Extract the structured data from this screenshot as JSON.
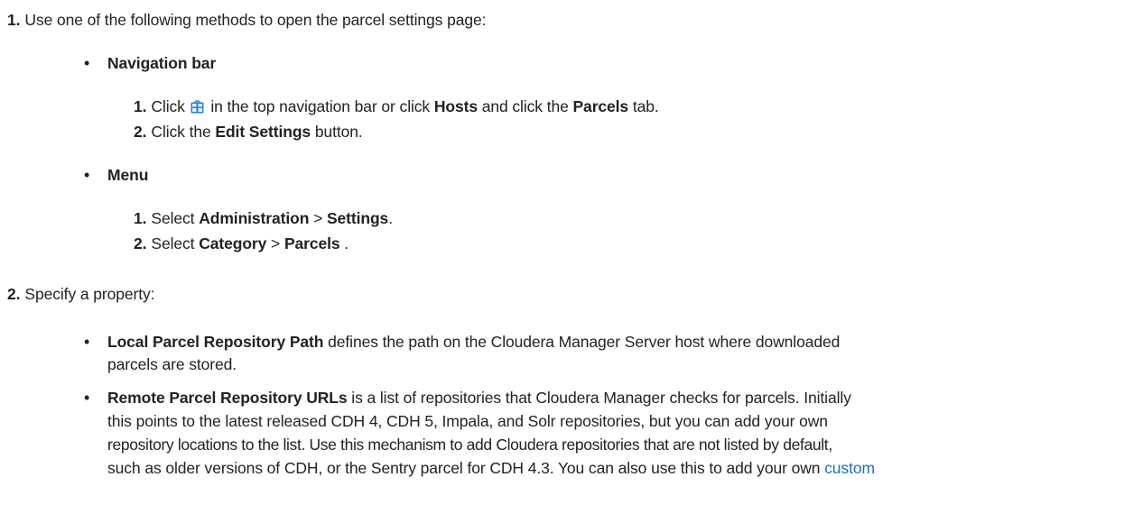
{
  "step1": {
    "num": "1.",
    "text": "Use one of the following methods to open the parcel settings page:",
    "nav": {
      "heading": "Navigation bar",
      "sub1": {
        "num": "1.",
        "click": "Click",
        "after_icon": "in the top navigation bar or click",
        "hosts": "Hosts",
        "and_click_the": "and click the",
        "parcels": "Parcels",
        "tab": "tab."
      },
      "sub2": {
        "num": "2.",
        "click_the": "Click the",
        "edit_settings": "Edit Settings",
        "button": "button."
      }
    },
    "menu": {
      "heading": "Menu",
      "sub1": {
        "num": "1.",
        "select": "Select",
        "administration": "Administration",
        "gt": ">",
        "settings": "Settings",
        "end": "."
      },
      "sub2": {
        "num": "2.",
        "select": "Select",
        "category": "Category",
        "gt": ">",
        "parcels": "Parcels",
        "end": "."
      }
    }
  },
  "step2": {
    "num": "2.",
    "text": "Specify a property:",
    "local": {
      "term": "Local Parcel Repository Path",
      "line1": "defines the path on the Cloudera Manager Server host where downloaded",
      "line2": "parcels are stored."
    },
    "remote": {
      "term": "Remote Parcel Repository URLs",
      "line1": "is a list of repositories that Cloudera Manager checks for parcels. Initially",
      "line2": "this points to the latest released CDH 4, CDH 5, Impala, and Solr repositories, but you can add your own",
      "line3": "repository locations to the list. Use this mechanism to add Cloudera repositories that are not listed by default,",
      "line4": "such as older versions of CDH, or the Sentry parcel for CDH 4.3. You can also use this to add your own",
      "link": "custom"
    }
  },
  "colors": {
    "text": "#222222",
    "link": "#1a6fc4",
    "icon": "#2a7fd4"
  },
  "icons": {
    "parcel": "parcel-gift-icon"
  }
}
